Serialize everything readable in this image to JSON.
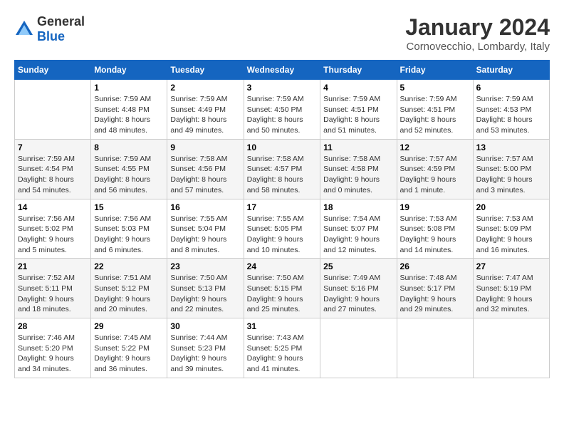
{
  "header": {
    "logo": {
      "text_general": "General",
      "text_blue": "Blue"
    },
    "month": "January 2024",
    "location": "Cornovecchio, Lombardy, Italy"
  },
  "days_of_week": [
    "Sunday",
    "Monday",
    "Tuesday",
    "Wednesday",
    "Thursday",
    "Friday",
    "Saturday"
  ],
  "weeks": [
    [
      {
        "day": "",
        "info": ""
      },
      {
        "day": "1",
        "info": "Sunrise: 7:59 AM\nSunset: 4:48 PM\nDaylight: 8 hours\nand 48 minutes."
      },
      {
        "day": "2",
        "info": "Sunrise: 7:59 AM\nSunset: 4:49 PM\nDaylight: 8 hours\nand 49 minutes."
      },
      {
        "day": "3",
        "info": "Sunrise: 7:59 AM\nSunset: 4:50 PM\nDaylight: 8 hours\nand 50 minutes."
      },
      {
        "day": "4",
        "info": "Sunrise: 7:59 AM\nSunset: 4:51 PM\nDaylight: 8 hours\nand 51 minutes."
      },
      {
        "day": "5",
        "info": "Sunrise: 7:59 AM\nSunset: 4:51 PM\nDaylight: 8 hours\nand 52 minutes."
      },
      {
        "day": "6",
        "info": "Sunrise: 7:59 AM\nSunset: 4:53 PM\nDaylight: 8 hours\nand 53 minutes."
      }
    ],
    [
      {
        "day": "7",
        "info": "Sunrise: 7:59 AM\nSunset: 4:54 PM\nDaylight: 8 hours\nand 54 minutes."
      },
      {
        "day": "8",
        "info": "Sunrise: 7:59 AM\nSunset: 4:55 PM\nDaylight: 8 hours\nand 56 minutes."
      },
      {
        "day": "9",
        "info": "Sunrise: 7:58 AM\nSunset: 4:56 PM\nDaylight: 8 hours\nand 57 minutes."
      },
      {
        "day": "10",
        "info": "Sunrise: 7:58 AM\nSunset: 4:57 PM\nDaylight: 8 hours\nand 58 minutes."
      },
      {
        "day": "11",
        "info": "Sunrise: 7:58 AM\nSunset: 4:58 PM\nDaylight: 9 hours\nand 0 minutes."
      },
      {
        "day": "12",
        "info": "Sunrise: 7:57 AM\nSunset: 4:59 PM\nDaylight: 9 hours\nand 1 minute."
      },
      {
        "day": "13",
        "info": "Sunrise: 7:57 AM\nSunset: 5:00 PM\nDaylight: 9 hours\nand 3 minutes."
      }
    ],
    [
      {
        "day": "14",
        "info": "Sunrise: 7:56 AM\nSunset: 5:02 PM\nDaylight: 9 hours\nand 5 minutes."
      },
      {
        "day": "15",
        "info": "Sunrise: 7:56 AM\nSunset: 5:03 PM\nDaylight: 9 hours\nand 6 minutes."
      },
      {
        "day": "16",
        "info": "Sunrise: 7:55 AM\nSunset: 5:04 PM\nDaylight: 9 hours\nand 8 minutes."
      },
      {
        "day": "17",
        "info": "Sunrise: 7:55 AM\nSunset: 5:05 PM\nDaylight: 9 hours\nand 10 minutes."
      },
      {
        "day": "18",
        "info": "Sunrise: 7:54 AM\nSunset: 5:07 PM\nDaylight: 9 hours\nand 12 minutes."
      },
      {
        "day": "19",
        "info": "Sunrise: 7:53 AM\nSunset: 5:08 PM\nDaylight: 9 hours\nand 14 minutes."
      },
      {
        "day": "20",
        "info": "Sunrise: 7:53 AM\nSunset: 5:09 PM\nDaylight: 9 hours\nand 16 minutes."
      }
    ],
    [
      {
        "day": "21",
        "info": "Sunrise: 7:52 AM\nSunset: 5:11 PM\nDaylight: 9 hours\nand 18 minutes."
      },
      {
        "day": "22",
        "info": "Sunrise: 7:51 AM\nSunset: 5:12 PM\nDaylight: 9 hours\nand 20 minutes."
      },
      {
        "day": "23",
        "info": "Sunrise: 7:50 AM\nSunset: 5:13 PM\nDaylight: 9 hours\nand 22 minutes."
      },
      {
        "day": "24",
        "info": "Sunrise: 7:50 AM\nSunset: 5:15 PM\nDaylight: 9 hours\nand 25 minutes."
      },
      {
        "day": "25",
        "info": "Sunrise: 7:49 AM\nSunset: 5:16 PM\nDaylight: 9 hours\nand 27 minutes."
      },
      {
        "day": "26",
        "info": "Sunrise: 7:48 AM\nSunset: 5:17 PM\nDaylight: 9 hours\nand 29 minutes."
      },
      {
        "day": "27",
        "info": "Sunrise: 7:47 AM\nSunset: 5:19 PM\nDaylight: 9 hours\nand 32 minutes."
      }
    ],
    [
      {
        "day": "28",
        "info": "Sunrise: 7:46 AM\nSunset: 5:20 PM\nDaylight: 9 hours\nand 34 minutes."
      },
      {
        "day": "29",
        "info": "Sunrise: 7:45 AM\nSunset: 5:22 PM\nDaylight: 9 hours\nand 36 minutes."
      },
      {
        "day": "30",
        "info": "Sunrise: 7:44 AM\nSunset: 5:23 PM\nDaylight: 9 hours\nand 39 minutes."
      },
      {
        "day": "31",
        "info": "Sunrise: 7:43 AM\nSunset: 5:25 PM\nDaylight: 9 hours\nand 41 minutes."
      },
      {
        "day": "",
        "info": ""
      },
      {
        "day": "",
        "info": ""
      },
      {
        "day": "",
        "info": ""
      }
    ]
  ]
}
